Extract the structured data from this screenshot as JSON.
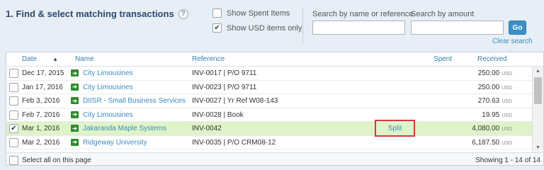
{
  "step": {
    "title": "1. Find & select matching transactions",
    "help_glyph": "?"
  },
  "options": {
    "show_spent": {
      "label": "Show Spent Items",
      "checked": false
    },
    "show_usd": {
      "label": "Show USD items only",
      "checked": true
    }
  },
  "search": {
    "name_label": "Search by name or reference",
    "name_value": "",
    "amount_label": "Search by amount",
    "amount_value": "",
    "go_label": "Go",
    "clear_label": "Clear search"
  },
  "table": {
    "headers": {
      "date": "Date",
      "name": "Name",
      "reference": "Reference",
      "spent": "Spent",
      "received": "Received"
    },
    "sort_glyph": "▲",
    "rows": [
      {
        "date": "Dec 17, 2015",
        "name": "City Limousines",
        "reference": "INV-0017 | P/O 9711",
        "spent": "",
        "received": "250.00",
        "currency": "USD",
        "checked": false,
        "selected": false
      },
      {
        "date": "Jan 17, 2016",
        "name": "City Limousines",
        "reference": "INV-0023 | P/O 9711",
        "spent": "",
        "received": "250.00",
        "currency": "USD",
        "checked": false,
        "selected": false
      },
      {
        "date": "Feb 3, 2016",
        "name": "DIISR - Small Business Services",
        "reference": "INV-0027 | Yr Ref W08-143",
        "spent": "",
        "received": "270.63",
        "currency": "USD",
        "checked": false,
        "selected": false
      },
      {
        "date": "Feb 7, 2016",
        "name": "City Limousines",
        "reference": "INV-0028 | Book",
        "spent": "",
        "received": "19.95",
        "currency": "USD",
        "checked": false,
        "selected": false
      },
      {
        "date": "Mar 1, 2016",
        "name": "Jakaranda Maple Systems",
        "reference": "INV-0042",
        "spent": "",
        "received": "4,080.00",
        "currency": "USD",
        "checked": true,
        "selected": true
      },
      {
        "date": "Mar 2, 2016",
        "name": "Ridgeway University",
        "reference": "INV-0035 | P/O CRM08-12",
        "spent": "",
        "received": "6,187.50",
        "currency": "USD",
        "checked": false,
        "selected": false
      }
    ],
    "split_label": "Split",
    "arrow_glyph": "➜",
    "check_glyph": "✔"
  },
  "footer": {
    "select_all_label": "Select all on this page",
    "showing": "Showing 1 - 14 of 14"
  },
  "colors": {
    "accent": "#3a8cbf",
    "selected_row": "#dff3c8",
    "highlight_border": "#d43a3a",
    "arrow_green": "#2e8b2e"
  }
}
